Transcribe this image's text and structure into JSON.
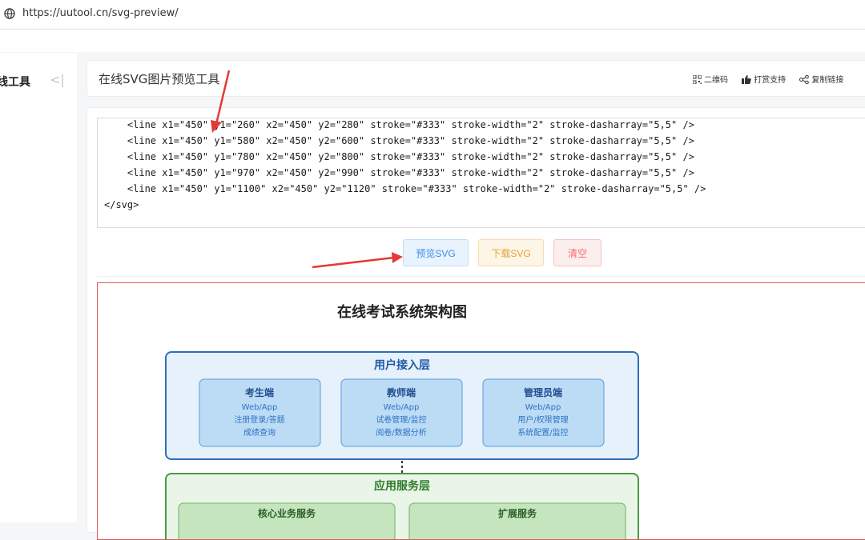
{
  "browser": {
    "url": "https://uutool.cn/svg-preview/"
  },
  "sidebar": {
    "title": "线工具",
    "collapse_glyph": "<|"
  },
  "header": {
    "title": "在线SVG图片预览工具",
    "actions": [
      {
        "label": "二维码",
        "icon": "qrcode-icon"
      },
      {
        "label": "打赏支持",
        "icon": "thumbs-up-icon"
      },
      {
        "label": "复制链接",
        "icon": "share-icon"
      }
    ]
  },
  "editor": {
    "lines": [
      "    <line x1=\"450\" y1=\"260\" x2=\"450\" y2=\"280\" stroke=\"#333\" stroke-width=\"2\" stroke-dasharray=\"5,5\" />",
      "    <line x1=\"450\" y1=\"580\" x2=\"450\" y2=\"600\" stroke=\"#333\" stroke-width=\"2\" stroke-dasharray=\"5,5\" />",
      "    <line x1=\"450\" y1=\"780\" x2=\"450\" y2=\"800\" stroke=\"#333\" stroke-width=\"2\" stroke-dasharray=\"5,5\" />",
      "    <line x1=\"450\" y1=\"970\" x2=\"450\" y2=\"990\" stroke=\"#333\" stroke-width=\"2\" stroke-dasharray=\"5,5\" />",
      "    <line x1=\"450\" y1=\"1100\" x2=\"450\" y2=\"1120\" stroke=\"#333\" stroke-width=\"2\" stroke-dasharray=\"5,5\" />",
      "</svg>"
    ]
  },
  "buttons": {
    "preview": "预览SVG",
    "download": "下载SVG",
    "clear": "清空"
  },
  "diagram": {
    "title": "在线考试系统架构图",
    "layer1": {
      "title": "用户接入层",
      "boxes": [
        {
          "title": "考生端",
          "lines": [
            "Web/App",
            "注册登录/答题",
            "成绩查询"
          ]
        },
        {
          "title": "教师端",
          "lines": [
            "Web/App",
            "试卷管理/监控",
            "阅卷/数据分析"
          ]
        },
        {
          "title": "管理员端",
          "lines": [
            "Web/App",
            "用户/权限管理",
            "系统配置/监控"
          ]
        }
      ]
    },
    "layer2": {
      "title": "应用服务层",
      "boxes": [
        {
          "title": "核心业务服务"
        },
        {
          "title": "扩展服务"
        }
      ]
    }
  },
  "colors": {
    "accent_blue": "#3a8ee6",
    "warning_orange": "#e6a23c",
    "danger_red": "#f56c6c",
    "layer1_fill": "#e6f1fc",
    "layer1_stroke": "#2f6fb5",
    "box_blue": "#bcdcf6",
    "layer2_fill": "#e9f5e6",
    "layer2_stroke": "#4a9a45",
    "box_green": "#c5e5bf",
    "annotation_arrow": "#e53935"
  }
}
